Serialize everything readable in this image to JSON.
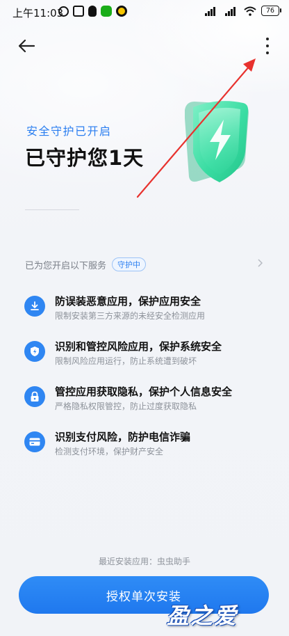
{
  "status_bar": {
    "time": "上午11:03",
    "battery": "76"
  },
  "header": {
    "back_icon": "arrow-left-icon",
    "more_icon": "more-vertical-icon"
  },
  "hero": {
    "subtitle": "安全守护已开启",
    "title": "已守护您1天",
    "illustration": "green-shield-lightning-icon"
  },
  "services": {
    "label": "已为您开启以下服务",
    "badge": "守护中",
    "items": [
      {
        "icon": "download-shield-icon",
        "title": "防误装恶意应用，保护应用安全",
        "desc": "限制安装第三方来源的未经安全检测应用"
      },
      {
        "icon": "shield-icon",
        "title": "识别和管控风险应用，保护系统安全",
        "desc": "限制风险应用运行，防止系统遭到破坏"
      },
      {
        "icon": "lock-icon",
        "title": "管控应用获取隐私，保护个人信息安全",
        "desc": "严格隐私权限管控，防止过度获取隐私"
      },
      {
        "icon": "card-icon",
        "title": "识别支付风险，防护电信诈骗",
        "desc": "检测支付环境，保护财产安全"
      }
    ]
  },
  "footer": {
    "recent_install": "最近安装应用：虫虫助手",
    "cta_label": "授权单次安装"
  },
  "watermark": "盈之爱",
  "colors": {
    "accent": "#2a7ef0",
    "button": "#2f8cf6",
    "shield_green": "#3fe0a8",
    "annotation_red": "#e8322e"
  }
}
